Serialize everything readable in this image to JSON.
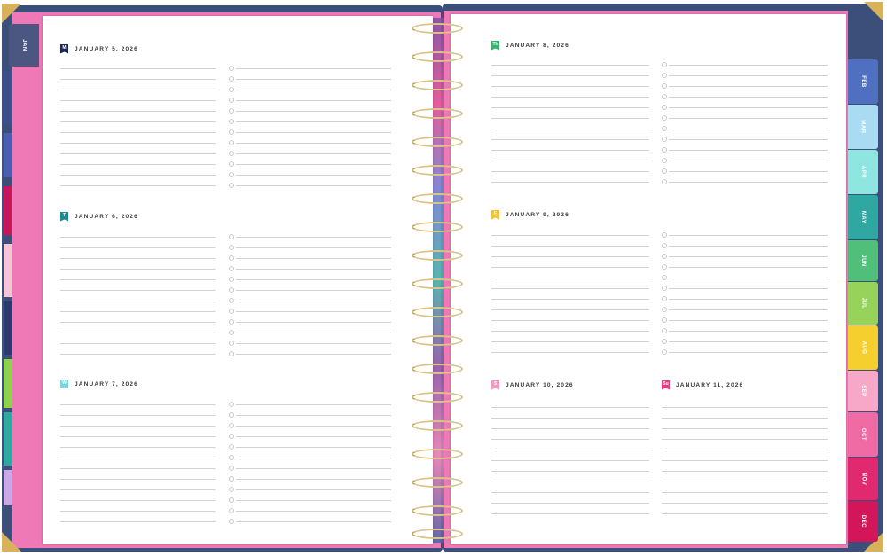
{
  "planner": {
    "left_page_days": [
      {
        "letter": "M",
        "date": "JANUARY 5, 2026",
        "color": "#1e2a4f"
      },
      {
        "letter": "T",
        "date": "JANUARY 6, 2026",
        "color": "#1f8b8f"
      },
      {
        "letter": "W",
        "date": "JANUARY 7, 2026",
        "color": "#7fd2da"
      }
    ],
    "right_page_days": [
      {
        "letter": "Th",
        "date": "JANUARY 8, 2026",
        "color": "#3bb36a"
      },
      {
        "letter": "F",
        "date": "JANUARY 9, 2026",
        "color": "#f2c43a"
      },
      {
        "letter": "S",
        "date": "JANUARY 10, 2026",
        "color": "#f29ac0"
      },
      {
        "letter": "Su",
        "date": "JANUARY 11, 2026",
        "color": "#e33f7f"
      }
    ],
    "month_tabs": [
      {
        "label": "JAN",
        "color": "#4b5780"
      },
      {
        "label": "FEB",
        "color": "#4f6fc0"
      },
      {
        "label": "MAR",
        "color": "#a9dcf2"
      },
      {
        "label": "APR",
        "color": "#8fe5e0"
      },
      {
        "label": "MAY",
        "color": "#2fa8a2"
      },
      {
        "label": "JUN",
        "color": "#4fbf7a"
      },
      {
        "label": "JUL",
        "color": "#97d25a"
      },
      {
        "label": "AUG",
        "color": "#f4cf2e"
      },
      {
        "label": "SEP",
        "color": "#f7a8c8"
      },
      {
        "label": "OCT",
        "color": "#f06aa3"
      },
      {
        "label": "NOV",
        "color": "#e0296e"
      },
      {
        "label": "DEC",
        "color": "#d3155a"
      }
    ]
  }
}
